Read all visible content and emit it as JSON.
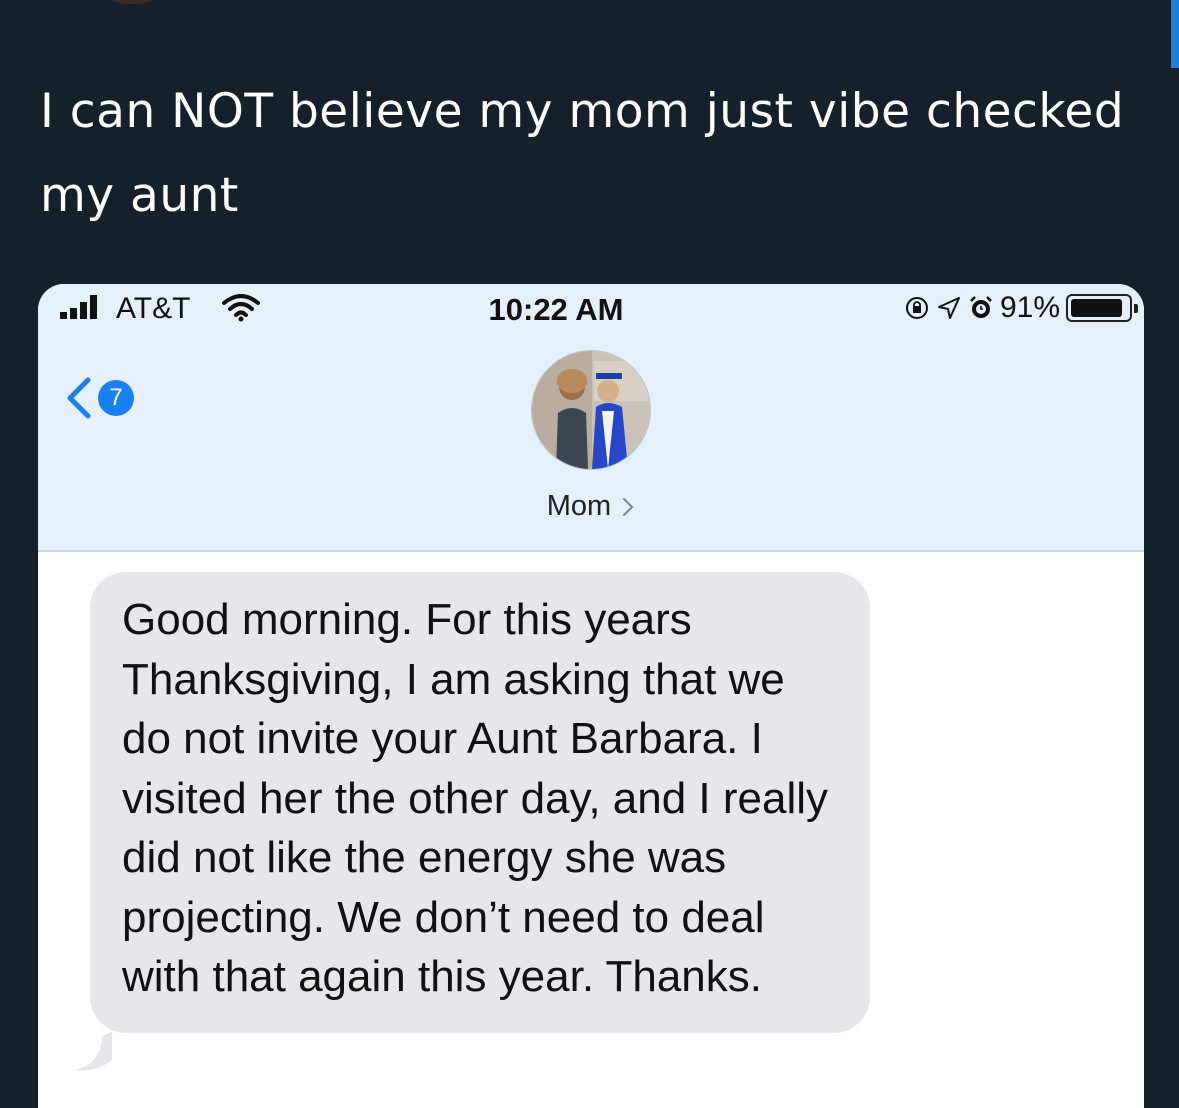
{
  "tweet": {
    "text": "I can NOT believe my mom just vibe checked my aunt"
  },
  "status_bar": {
    "carrier": "AT&T",
    "time": "10:22 AM",
    "battery_text": "91%",
    "battery_level": 0.91,
    "icons": [
      "signal-bars-icon",
      "wifi-icon",
      "orientation-lock-icon",
      "location-arrow-icon",
      "alarm-icon",
      "battery-icon"
    ]
  },
  "nav": {
    "back_icon": "chevron-left-icon",
    "unread_count": "7"
  },
  "contact": {
    "name": "Mom",
    "chevron_icon": "chevron-right-icon"
  },
  "message": {
    "text": "Good morning. For this years Thanksgiving, I am asking that we do not invite your Aunt Barbara. I visited her the other day, and I really did not like the energy she was projecting. We don’t need to deal with that again this year. Thanks."
  },
  "colors": {
    "tweet_background": "#15202b",
    "tweet_text": "#ffffff",
    "header_background": "#e6f0fa",
    "bubble_background": "#e6e6eb",
    "ios_blue": "#1a7ff0"
  }
}
